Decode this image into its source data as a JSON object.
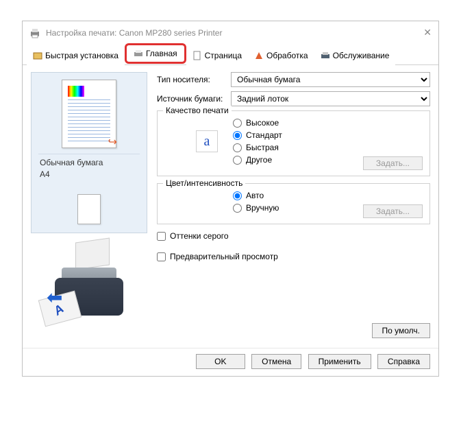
{
  "titlebar": {
    "title": "Настройка печати: Canon MP280 series Printer"
  },
  "tabs": {
    "quick": "Быстрая установка",
    "main": "Главная",
    "page": "Страница",
    "effects": "Обработка",
    "maint": "Обслуживание"
  },
  "preview": {
    "media": "Обычная бумага",
    "size": "A4"
  },
  "settings": {
    "media_label": "Тип носителя:",
    "media_value": "Обычная бумага",
    "source_label": "Источник бумаги:",
    "source_value": "Задний лоток",
    "quality": {
      "title": "Качество печати",
      "high": "Высокое",
      "standard": "Стандарт",
      "fast": "Быстрая",
      "other": "Другое",
      "set_btn": "Задать..."
    },
    "color": {
      "title": "Цвет/интенсивность",
      "auto": "Авто",
      "manual": "Вручную",
      "set_btn": "Задать..."
    },
    "grayscale": "Оттенки серого",
    "preview_chk": "Предварительный просмотр",
    "defaults_btn": "По умолч."
  },
  "footer": {
    "ok": "OK",
    "cancel": "Отмена",
    "apply": "Применить",
    "help": "Справка"
  }
}
